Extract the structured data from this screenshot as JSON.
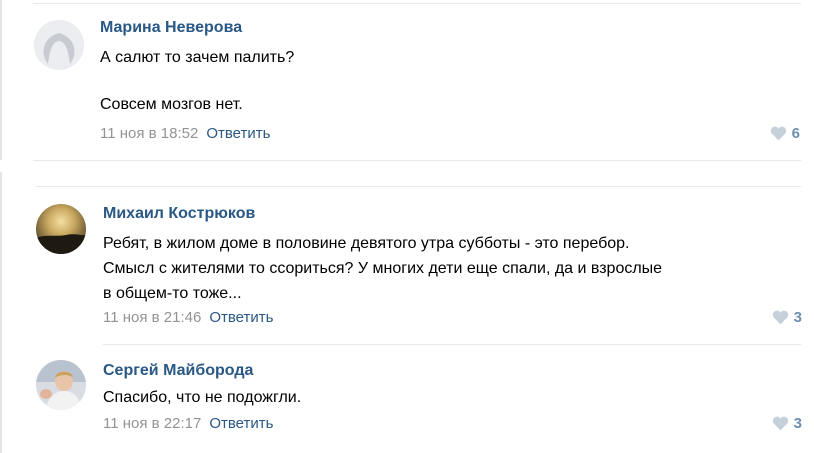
{
  "colors": {
    "author": "#2a5885",
    "date": "#939393",
    "reply": "#2a5885",
    "likes": "#6f8eb0",
    "divider": "#e7e8ec"
  },
  "comments": [
    {
      "author": "Марина Неверова",
      "lines": [
        "А салют то зачем палить?",
        "",
        "Совсем мозгов нет."
      ],
      "date": "11 ноя в 18:52",
      "reply": "Ответить",
      "likes": "6",
      "avatar": "default-avatar"
    },
    {
      "author": "Михаил Кострюков",
      "lines": [
        "Ребят, в жилом доме в половине девятого утра субботы - это перебор.",
        "Смысл с жителями то ссориться? У многих дети еще спали, да и взрослые",
        "в общем-то тоже..."
      ],
      "date": "11 ноя в 21:46",
      "reply": "Ответить",
      "likes": "3",
      "avatar": "sunset-avatar"
    },
    {
      "author": "Сергей Майборода",
      "lines": [
        "Спасибо, что не подожгли."
      ],
      "date": "11 ноя в 22:17",
      "reply": "Ответить",
      "likes": "3",
      "avatar": "photo-avatar"
    }
  ]
}
